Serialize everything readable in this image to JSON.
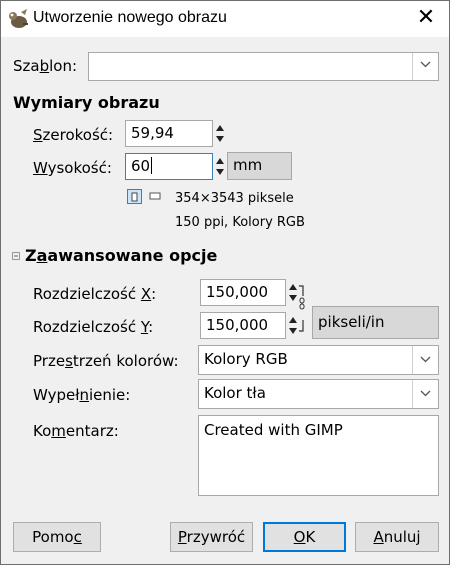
{
  "window": {
    "title": "Utworzenie nowego obrazu",
    "close_label": "✕"
  },
  "template": {
    "label_pre": "Sza",
    "label_u": "b",
    "label_post": "lon:",
    "value": ""
  },
  "dimensions": {
    "heading": "Wymiary obrazu",
    "width_label_u": "S",
    "width_label_post": "zerokość:",
    "width_value": "59,94",
    "height_label_u": "W",
    "height_label_post": "ysokość:",
    "height_value": "60",
    "unit": "mm",
    "pixel_info": "354×3543 piksele",
    "res_info": "150 ppi, Kolory RGB"
  },
  "advanced": {
    "heading_pre": "Z",
    "heading_u": "a",
    "heading_post": "awansowane opcje",
    "xres_label_pre": "Rozdzielczość ",
    "xres_label_u": "X",
    "xres_label_post": ":",
    "xres_value": "150,000",
    "yres_label_pre": "Rozdzielczość ",
    "yres_label_u": "Y",
    "yres_label_post": ":",
    "yres_value": "150,000",
    "res_unit": "pikseli/in",
    "colorspace_label_pre": "Prze",
    "colorspace_label_u": "s",
    "colorspace_label_post": "trzeń kolorów:",
    "colorspace_value": "Kolory RGB",
    "fill_label_pre": "Wypeł",
    "fill_label_u": "n",
    "fill_label_post": "ienie:",
    "fill_value": "Kolor tła",
    "comment_label_pre": "Ko",
    "comment_label_u": "m",
    "comment_label_post": "entarz:",
    "comment_value": "Created with GIMP"
  },
  "buttons": {
    "help_pre": "Pomo",
    "help_u": "c",
    "reset_u": "P",
    "reset_post": "rzywróć",
    "ok_u": "O",
    "ok_post": "K",
    "cancel_u": "A",
    "cancel_post": "nuluj"
  }
}
